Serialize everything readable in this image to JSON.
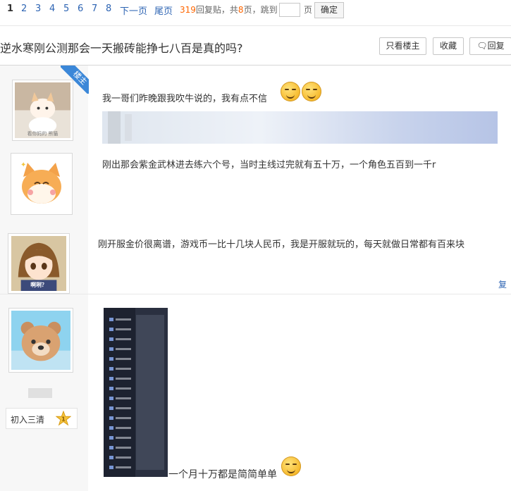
{
  "pager": {
    "current": "1",
    "pages": [
      "2",
      "3",
      "4",
      "5",
      "6",
      "7",
      "8"
    ],
    "next": "下一页",
    "last": "尾页",
    "reply_count": "319",
    "reply_suffix": "回复贴，共",
    "page_total": "8",
    "page_suffix": "页，",
    "jump_label": "跳到",
    "jump_unit": "页",
    "confirm": "确定"
  },
  "thread": {
    "title": "逆水寒刚公测那会一天搬砖能挣七八百是真的吗?",
    "only_op": "只看楼主",
    "favorite": "收藏",
    "reply": "回复"
  },
  "op_badge": "楼主",
  "posts": [
    {
      "text1": "我一哥们昨晚跟我吹牛说的，我有点不信",
      "text2": "刚出那会紫金武林进去练六个号，当时主线过完就有五十万，一个角色五百到一千r",
      "avatar_caption": "看你妈的 熊猫"
    },
    {
      "text": "刚开服金价很离谱，游戏币一比十几块人民币，我是开服就玩的，每天就做日常都有百来块",
      "avatar_caption": "啊咧？",
      "reply_link": "复"
    },
    {
      "level_label": "初入三清",
      "level_num": "1",
      "text": "一个月十万都是简简单单"
    }
  ]
}
